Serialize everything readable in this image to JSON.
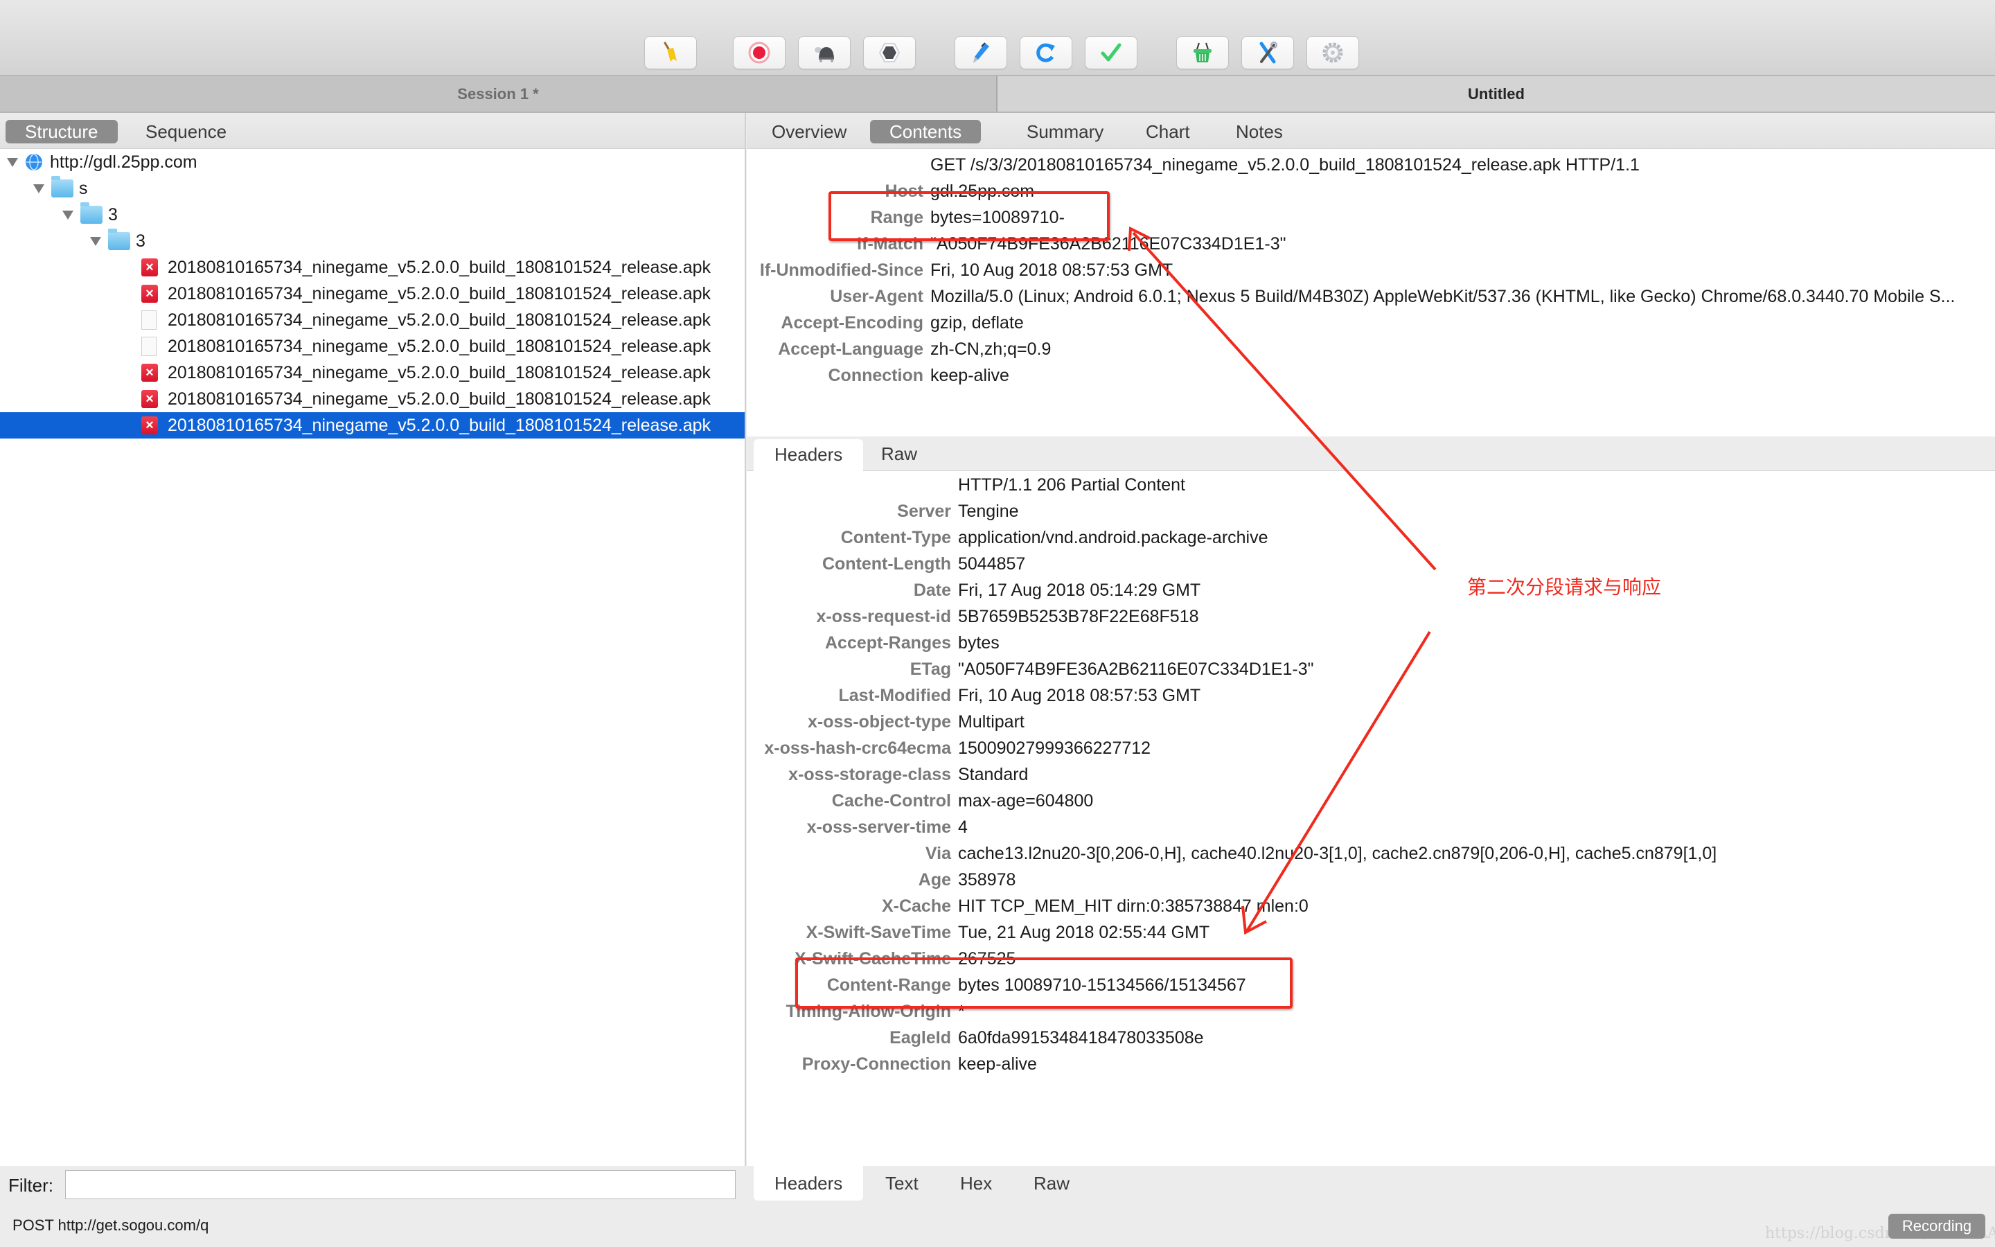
{
  "toolbar": {
    "buttons": [
      {
        "icon": "broom-icon",
        "label": "Clear"
      },
      {
        "icon": "record-icon",
        "label": "Record"
      },
      {
        "icon": "turtle-icon",
        "label": "Throttle"
      },
      {
        "icon": "stop-icon",
        "label": "Breakpoints"
      },
      {
        "icon": "pen-icon",
        "label": "Edit"
      },
      {
        "icon": "refresh-icon",
        "label": "Repeat"
      },
      {
        "icon": "check-icon",
        "label": "Validate"
      },
      {
        "icon": "basket-icon",
        "label": "Tools"
      },
      {
        "icon": "tools-icon",
        "label": "Settings"
      },
      {
        "icon": "gear-icon",
        "label": "Preferences"
      }
    ]
  },
  "sessions": [
    {
      "label": "Session 1 *",
      "active": false
    },
    {
      "label": "Untitled",
      "active": true
    }
  ],
  "left": {
    "tabs": [
      {
        "label": "Structure",
        "active": true
      },
      {
        "label": "Sequence",
        "active": false
      }
    ],
    "tree": {
      "host": "http://gdl.25pp.com",
      "folders": [
        "s",
        "3",
        "3"
      ],
      "files": [
        {
          "name": "20180810165734_ninegame_v5.2.0.0_build_1808101524_release.apk",
          "status": "error"
        },
        {
          "name": "20180810165734_ninegame_v5.2.0.0_build_1808101524_release.apk",
          "status": "error"
        },
        {
          "name": "20180810165734_ninegame_v5.2.0.0_build_1808101524_release.apk",
          "status": "ok"
        },
        {
          "name": "20180810165734_ninegame_v5.2.0.0_build_1808101524_release.apk",
          "status": "ok"
        },
        {
          "name": "20180810165734_ninegame_v5.2.0.0_build_1808101524_release.apk",
          "status": "error"
        },
        {
          "name": "20180810165734_ninegame_v5.2.0.0_build_1808101524_release.apk",
          "status": "error"
        },
        {
          "name": "20180810165734_ninegame_v5.2.0.0_build_1808101524_release.apk",
          "status": "error",
          "selected": true
        }
      ]
    },
    "filter": {
      "label": "Filter:",
      "value": "",
      "placeholder": ""
    }
  },
  "right": {
    "tabs": [
      {
        "label": "Overview",
        "active": false
      },
      {
        "label": "Contents",
        "active": true
      },
      {
        "label": "Summary",
        "active": false
      },
      {
        "label": "Chart",
        "active": false
      },
      {
        "label": "Notes",
        "active": false
      }
    ],
    "request": {
      "request_line": "GET /s/3/3/20180810165734_ninegame_v5.2.0.0_build_1808101524_release.apk HTTP/1.1",
      "headers": [
        {
          "k": "Host",
          "v": "gdl.25pp.com"
        },
        {
          "k": "Range",
          "v": "bytes=10089710-"
        },
        {
          "k": "If-Match",
          "v": "\"A050F74B9FE36A2B62116E07C334D1E1-3\""
        },
        {
          "k": "If-Unmodified-Since",
          "v": "Fri, 10 Aug 2018 08:57:53 GMT"
        },
        {
          "k": "User-Agent",
          "v": "Mozilla/5.0 (Linux; Android 6.0.1; Nexus 5 Build/M4B30Z) AppleWebKit/537.36 (KHTML, like Gecko) Chrome/68.0.3440.70 Mobile S..."
        },
        {
          "k": "Accept-Encoding",
          "v": "gzip, deflate"
        },
        {
          "k": "Accept-Language",
          "v": "zh-CN,zh;q=0.9"
        },
        {
          "k": "Connection",
          "v": "keep-alive"
        }
      ]
    },
    "request_tabs": [
      {
        "label": "Headers",
        "active": true
      },
      {
        "label": "Raw",
        "active": false
      }
    ],
    "response": {
      "status_line": "HTTP/1.1 206 Partial Content",
      "headers": [
        {
          "k": "Server",
          "v": "Tengine"
        },
        {
          "k": "Content-Type",
          "v": "application/vnd.android.package-archive"
        },
        {
          "k": "Content-Length",
          "v": "5044857"
        },
        {
          "k": "Date",
          "v": "Fri, 17 Aug 2018 05:14:29 GMT"
        },
        {
          "k": "x-oss-request-id",
          "v": "5B7659B5253B78F22E68F518"
        },
        {
          "k": "Accept-Ranges",
          "v": "bytes"
        },
        {
          "k": "ETag",
          "v": "\"A050F74B9FE36A2B62116E07C334D1E1-3\""
        },
        {
          "k": "Last-Modified",
          "v": "Fri, 10 Aug 2018 08:57:53 GMT"
        },
        {
          "k": "x-oss-object-type",
          "v": "Multipart"
        },
        {
          "k": "x-oss-hash-crc64ecma",
          "v": "15009027999366227712"
        },
        {
          "k": "x-oss-storage-class",
          "v": "Standard"
        },
        {
          "k": "Cache-Control",
          "v": "max-age=604800"
        },
        {
          "k": "x-oss-server-time",
          "v": "4"
        },
        {
          "k": "Via",
          "v": "cache13.l2nu20-3[0,206-0,H], cache40.l2nu20-3[1,0], cache2.cn879[0,206-0,H], cache5.cn879[1,0]"
        },
        {
          "k": "Age",
          "v": "358978"
        },
        {
          "k": "X-Cache",
          "v": "HIT TCP_MEM_HIT dirn:0:385738847 mlen:0"
        },
        {
          "k": "X-Swift-SaveTime",
          "v": "Tue, 21 Aug 2018 02:55:44 GMT"
        },
        {
          "k": "X-Swift-CacheTime",
          "v": "267525"
        },
        {
          "k": "Content-Range",
          "v": "bytes 10089710-15134566/15134567"
        },
        {
          "k": "Timing-Allow-Origin",
          "v": "*"
        },
        {
          "k": "EagleId",
          "v": "6a0fda9915348418478033508e"
        },
        {
          "k": "Proxy-Connection",
          "v": "keep-alive"
        }
      ]
    },
    "response_tabs": [
      {
        "label": "Headers",
        "active": true
      },
      {
        "label": "Text",
        "active": false
      },
      {
        "label": "Hex",
        "active": false
      },
      {
        "label": "Raw",
        "active": false
      }
    ]
  },
  "status": {
    "text": "POST http://get.sogou.com/q",
    "recording_label": "Recording",
    "watermark": "https://blog.csdn.net/SCHOLAR_II"
  },
  "annotation": {
    "text": "第二次分段请求与响应",
    "color": "#f02a1e"
  }
}
